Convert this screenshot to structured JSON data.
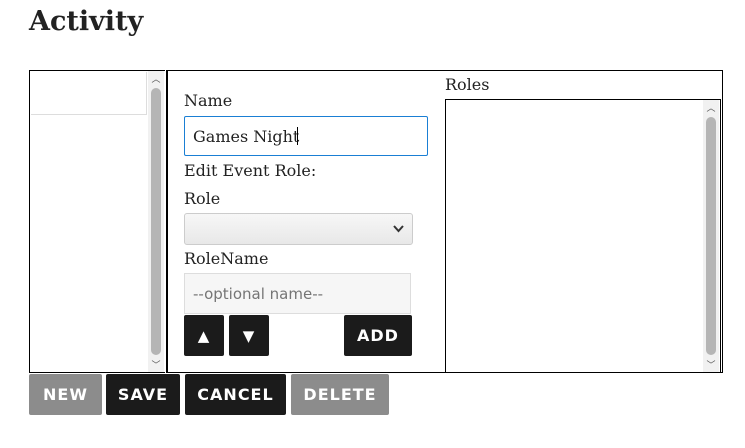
{
  "page_title": "Activity",
  "form": {
    "name_label": "Name",
    "name_value": "Games Night",
    "edit_role_heading": "Edit Event Role:",
    "role_label": "Role",
    "role_selected": "",
    "role_name_label": "RoleName",
    "role_name_placeholder": "--optional name--",
    "move_up_label": "▲",
    "move_down_label": "▼",
    "add_label": "ADD"
  },
  "roles": {
    "label": "Roles",
    "items": []
  },
  "activity_list": {
    "items": [
      ""
    ]
  },
  "actions": {
    "new": "NEW",
    "save": "SAVE",
    "cancel": "CANCEL",
    "delete": "DELETE"
  }
}
